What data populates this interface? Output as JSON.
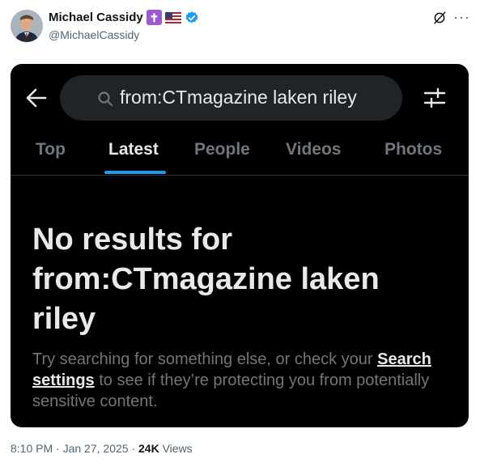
{
  "author": {
    "name": "Michael Cassidy",
    "handle": "@MichaelCassidy",
    "badges": [
      "cross-emoji",
      "us-flag-emoji",
      "verified-badge"
    ]
  },
  "screenshot": {
    "search_query": "from:CTmagazine laken riley",
    "tabs": [
      {
        "label": "Top",
        "active": false
      },
      {
        "label": "Latest",
        "active": true
      },
      {
        "label": "People",
        "active": false
      },
      {
        "label": "Videos",
        "active": false
      },
      {
        "label": "Photos",
        "active": false
      }
    ],
    "no_results_title": "No results for from:CTmagazine laken riley",
    "suggestion_before": "Try searching for something else, or check your ",
    "suggestion_link": "Search settings",
    "suggestion_after": " to see if they’re protecting you from potentially sensitive content."
  },
  "meta": {
    "time": "8:10 PM",
    "separator": " · ",
    "date": "Jan 27, 2025",
    "views_count": "24K",
    "views_label": " Views"
  },
  "colors": {
    "accent": "#1d9bf0",
    "card_background": "#000000",
    "search_bar": "#202327"
  }
}
